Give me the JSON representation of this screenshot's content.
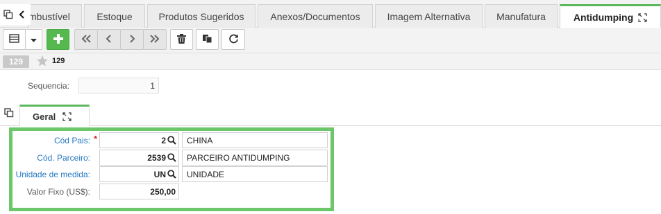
{
  "tabs": [
    {
      "label": "mbustível"
    },
    {
      "label": "Estoque"
    },
    {
      "label": "Produtos Sugeridos"
    },
    {
      "label": "Anexos/Documentos"
    },
    {
      "label": "Imagem Alternativa"
    },
    {
      "label": "Manufatura"
    },
    {
      "label": "Antidumping",
      "active": true
    }
  ],
  "record": {
    "badge": "129",
    "favorite_count": "129"
  },
  "sequencia": {
    "label": "Sequencia:",
    "value": "1"
  },
  "subtab": {
    "label": "Geral"
  },
  "form": {
    "cod_pais": {
      "label": "Cód Pais:",
      "required_mark": "*",
      "code": "2",
      "description": "CHINA"
    },
    "cod_parceiro": {
      "label": "Cód. Parceiro:",
      "code": "2539",
      "description": "PARCEIRO ANTIDUMPING"
    },
    "unidade": {
      "label": "Unidade de medida:",
      "code": "UN",
      "description": "UNIDADE"
    },
    "valor_fixo": {
      "label": "Valor Fixo (US$):",
      "value": "250,00"
    }
  },
  "colors": {
    "accent_green": "#5cb85c",
    "highlight_green": "#6cc66a",
    "link_blue": "#2479c1",
    "required_red": "#d9302c"
  },
  "icons": {
    "toolbar": [
      "grid-view-icon",
      "caret-down-icon",
      "plus-icon",
      "first-record-icon",
      "previous-record-icon",
      "next-record-icon",
      "last-record-icon",
      "trash-icon",
      "duplicate-icon",
      "refresh-icon"
    ],
    "other": [
      "copy-icon",
      "chevron-left-icon",
      "expand-icon",
      "star-icon",
      "search-icon"
    ]
  }
}
